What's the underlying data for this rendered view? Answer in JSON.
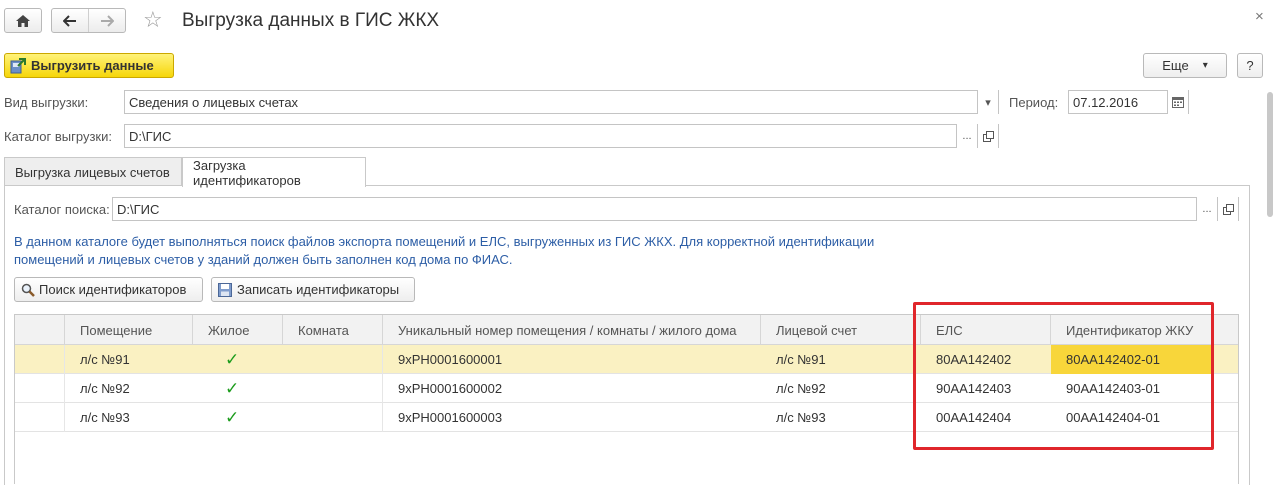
{
  "window": {
    "title": "Выгрузка данных в ГИС ЖКХ",
    "close_glyph": "×"
  },
  "icons": {
    "home": "home-icon",
    "back": "arrow-left-icon",
    "forward": "arrow-right-icon",
    "favorite": "star-icon",
    "close": "close-icon"
  },
  "toolbar": {
    "export_label": "Выгрузить данные",
    "more_label": "Еще",
    "more_arrow": "▾",
    "help_label": "?"
  },
  "form": {
    "export_type_label": "Вид выгрузки:",
    "export_type_value": "Сведения о лицевых счетах",
    "period_label": "Период:",
    "period_value": "07.12.2016",
    "catalog_label": "Каталог выгрузки:",
    "catalog_value": "D:\\ГИС",
    "ellipsis": "...",
    "dropdown_arrow": "▾"
  },
  "tabs": [
    {
      "label": "Выгрузка лицевых счетов",
      "active": false
    },
    {
      "label": "Загрузка идентификаторов",
      "active": true
    }
  ],
  "panel": {
    "search_catalog_label": "Каталог поиска:",
    "search_catalog_value": "D:\\ГИС",
    "info_text": "В данном каталоге будет выполняться поиск файлов экспорта помещений и ЕЛС, выгруженных из ГИС ЖКХ. Для корректной идентификации помещений и лицевых счетов у зданий должен быть заполнен код дома по ФИАС.",
    "search_button": "Поиск идентификаторов",
    "save_button": "Записать идентификаторы"
  },
  "table": {
    "columns": [
      "Помещение",
      "Жилое",
      "Комната",
      "Уникальный номер помещения / комнаты / жилого дома",
      "Лицевой счет",
      "ЕЛС",
      "Идентификатор ЖКУ"
    ],
    "rows": [
      {
        "room": "л/с №91",
        "residential": "✓",
        "subroom": "",
        "unique": "9xPH0001600001",
        "account": "л/с №91",
        "els": "80АА142402",
        "id": "80АА142402-01",
        "selected": true
      },
      {
        "room": "л/с №92",
        "residential": "✓",
        "subroom": "",
        "unique": "9xPH0001600002",
        "account": "л/с №92",
        "els": "90АА142403",
        "id": "90АА142403-01",
        "selected": false
      },
      {
        "room": "л/с №93",
        "residential": "✓",
        "subroom": "",
        "unique": "9xPH0001600003",
        "account": "л/с №93",
        "els": "00АА142404",
        "id": "00АА142404-01",
        "selected": false
      }
    ]
  },
  "colors": {
    "primary_button": "#f6d60a",
    "selected_row": "#faf1c2",
    "highlight_cell": "#f8d63a",
    "annotation_box": "#e0262b",
    "info_text": "#2d5ea6",
    "check": "#1c9c1c"
  }
}
